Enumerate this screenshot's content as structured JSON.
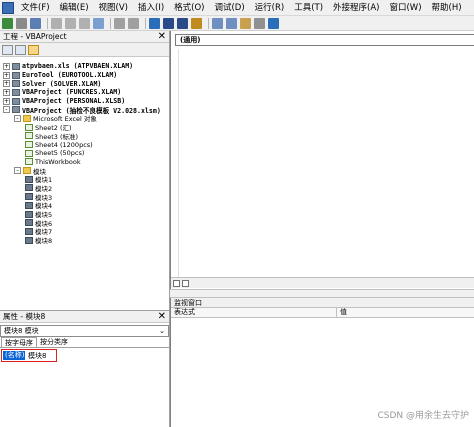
{
  "menubar": {
    "items": [
      "文件(F)",
      "编辑(E)",
      "视图(V)",
      "插入(I)",
      "格式(O)",
      "调试(D)",
      "运行(R)",
      "工具(T)",
      "外接程序(A)",
      "窗口(W)",
      "帮助(H)"
    ]
  },
  "project_panel": {
    "title": "工程 - VBAProject",
    "close": "✕",
    "tree": [
      {
        "level": 0,
        "exp": "+",
        "icon": "proj",
        "text": "atpvbaen.xls (ATPVBAEN.XLAM)"
      },
      {
        "level": 0,
        "exp": "+",
        "icon": "proj",
        "text": "EuroTool (EUROTOOL.XLAM)"
      },
      {
        "level": 0,
        "exp": "+",
        "icon": "proj",
        "text": "Solver (SOLVER.XLAM)"
      },
      {
        "level": 0,
        "exp": "+",
        "icon": "proj",
        "text": "VBAProject (FUNCRES.XLAM)"
      },
      {
        "level": 0,
        "exp": "+",
        "icon": "proj",
        "text": "VBAProject (PERSONAL.XLSB)"
      },
      {
        "level": 0,
        "exp": "-",
        "icon": "proj",
        "text": "VBAProject (抽检不良模板 V2.028.xlsm)"
      },
      {
        "level": 1,
        "exp": "-",
        "icon": "folder",
        "text": "Microsoft Excel 对象",
        "norm": true
      },
      {
        "level": 2,
        "exp": "",
        "icon": "sheet",
        "text": "Sheet2 (汇)",
        "norm": true
      },
      {
        "level": 2,
        "exp": "",
        "icon": "sheet",
        "text": "Sheet3 (标准)",
        "norm": true
      },
      {
        "level": 2,
        "exp": "",
        "icon": "sheet",
        "text": "Sheet4 (1200pcs)",
        "norm": true
      },
      {
        "level": 2,
        "exp": "",
        "icon": "sheet",
        "text": "Sheet5 (50pcs)",
        "norm": true
      },
      {
        "level": 2,
        "exp": "",
        "icon": "sheet",
        "text": "ThisWorkbook",
        "norm": true
      },
      {
        "level": 1,
        "exp": "-",
        "icon": "folder",
        "text": "模块",
        "norm": true
      },
      {
        "level": 2,
        "exp": "",
        "icon": "mod",
        "text": "模块1",
        "norm": true
      },
      {
        "level": 2,
        "exp": "",
        "icon": "mod",
        "text": "模块2",
        "norm": true
      },
      {
        "level": 2,
        "exp": "",
        "icon": "mod",
        "text": "模块3",
        "norm": true
      },
      {
        "level": 2,
        "exp": "",
        "icon": "mod",
        "text": "模块4",
        "norm": true
      },
      {
        "level": 2,
        "exp": "",
        "icon": "mod",
        "text": "模块5",
        "norm": true
      },
      {
        "level": 2,
        "exp": "",
        "icon": "mod",
        "text": "模块6",
        "norm": true
      },
      {
        "level": 2,
        "exp": "",
        "icon": "mod",
        "text": "模块7",
        "norm": true
      },
      {
        "level": 2,
        "exp": "",
        "icon": "mod",
        "text": "模块8",
        "norm": true
      }
    ]
  },
  "properties_panel": {
    "title": "属性 - 模块8",
    "close": "✕",
    "selected_object": "模块8 模块",
    "tabs": [
      "按字母序",
      "按分类序"
    ],
    "row_key": "(名称)",
    "row_value": "模块8"
  },
  "code_window": {
    "object_dropdown": "(通用)"
  },
  "watch_window": {
    "title": "监视窗口",
    "col_expression": "表达式",
    "col_value": "值"
  },
  "watermark": "CSDN @用余生去守护",
  "colors": {
    "selection": "#0a64d6",
    "highlight_box": "#e02020"
  }
}
